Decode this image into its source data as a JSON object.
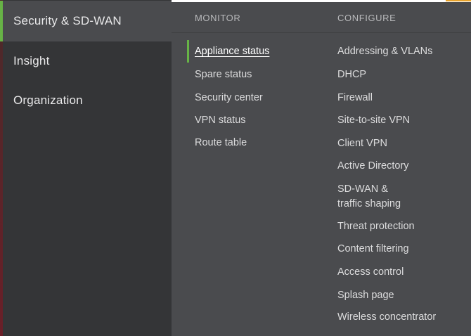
{
  "sidebar": {
    "items": [
      {
        "label": "Security & SD-WAN",
        "active": true
      },
      {
        "label": "Insight",
        "active": false
      },
      {
        "label": "Organization",
        "active": false
      }
    ]
  },
  "flyout": {
    "monitor": {
      "header": "MONITOR",
      "items": [
        {
          "label": "Appliance status",
          "current": true
        },
        {
          "label": "Spare status"
        },
        {
          "label": "Security center"
        },
        {
          "label": "VPN status"
        },
        {
          "label": "Route table"
        }
      ]
    },
    "configure": {
      "header": "CONFIGURE",
      "items": [
        {
          "label": "Addressing & VLANs"
        },
        {
          "label": "DHCP"
        },
        {
          "label": "Firewall"
        },
        {
          "label": "Site-to-site VPN"
        },
        {
          "label": "Client VPN"
        },
        {
          "label": "Active Directory"
        },
        {
          "label_line1": "SD-WAN &",
          "label_line2": "traffic shaping"
        },
        {
          "label": "Threat protection"
        },
        {
          "label": "Content filtering"
        },
        {
          "label": "Access control"
        },
        {
          "label": "Splash page"
        },
        {
          "label": "Wireless concentrator"
        }
      ]
    }
  },
  "colors": {
    "sidebar_bg": "#343537",
    "flyout_bg": "#4a4b4e",
    "accent_green": "#67b346"
  }
}
